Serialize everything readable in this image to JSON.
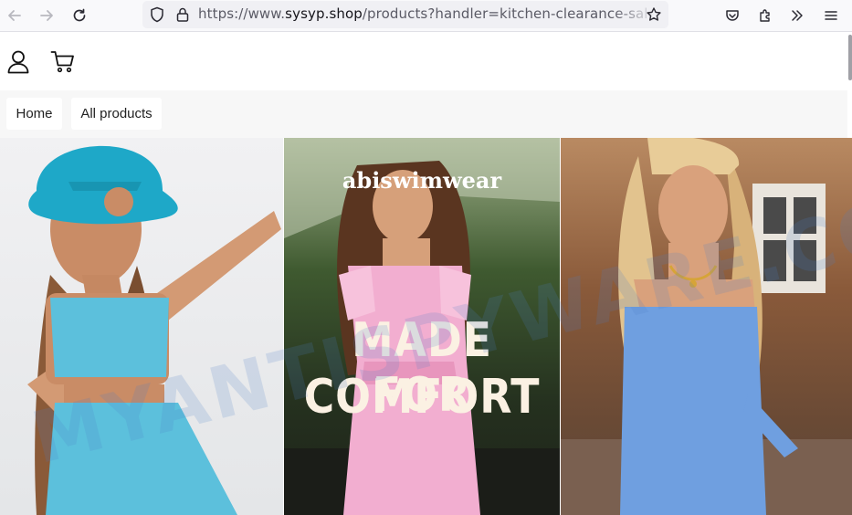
{
  "browser": {
    "url_prefix": "https://www.",
    "url_domain": "sysyp.shop",
    "url_path": "/products?handler=kitchen-clearance-sale&",
    "icons": [
      "back-arrow-icon",
      "forward-arrow-icon",
      "reload-icon",
      "shield-icon",
      "lock-icon",
      "bookmark-star-icon",
      "pocket-icon",
      "extensions-icon",
      "overflow-chevrons-icon",
      "hamburger-menu-icon"
    ]
  },
  "header": {
    "icons": [
      "account-icon",
      "cart-icon"
    ]
  },
  "nav": {
    "items": [
      {
        "label": "Home"
      },
      {
        "label": "All products"
      }
    ]
  },
  "banner": {
    "brand": "abiswimwear",
    "headline_line1": "MADE FOR",
    "headline_line2": "COMFORT",
    "watermark": "MYANTISPYWARE.COM",
    "colors": {
      "hat": "#1ea8c8",
      "gingham": "#5cc0dc",
      "pink_dress": "#f2aed0",
      "blue_dress": "#6f9fe0",
      "headline": "#fbf1e3"
    }
  }
}
